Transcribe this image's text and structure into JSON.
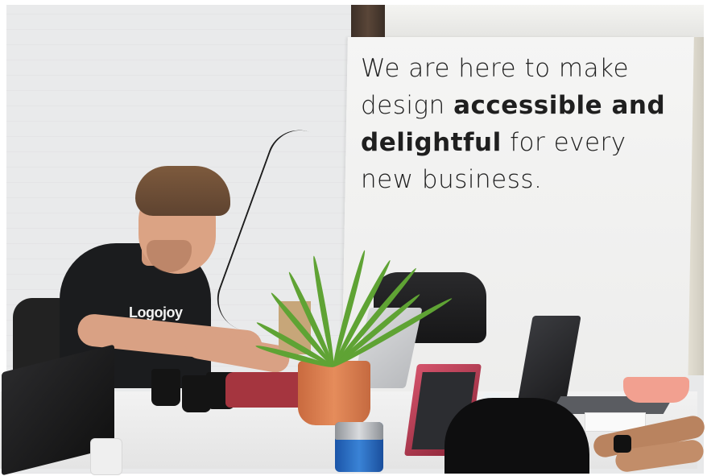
{
  "scene": {
    "sign": {
      "line1": "We are here to make",
      "line2_regular": "design ",
      "line2_bold": "accessible and",
      "line3_bold": "delightful",
      "line3_regular": " for every",
      "line4": "new business."
    },
    "shirt_logo": "Logojoy"
  }
}
